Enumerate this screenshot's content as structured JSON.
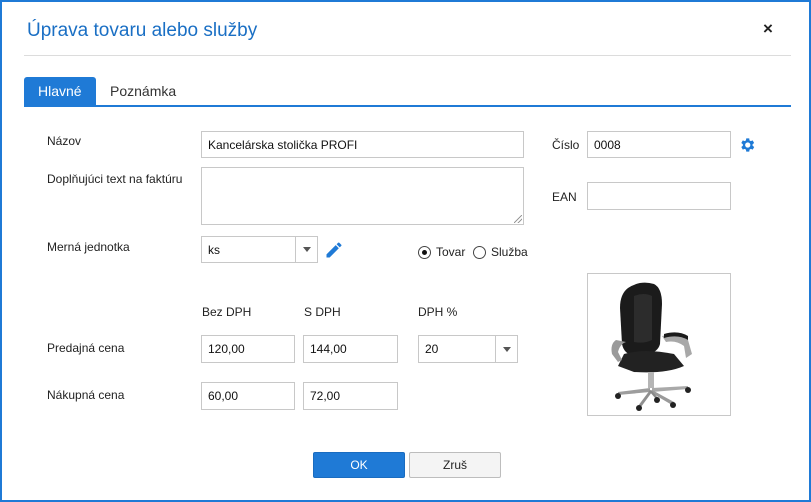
{
  "dialog": {
    "title": "Úprava tovaru alebo služby",
    "close_label": "×"
  },
  "tabs": [
    {
      "label": "Hlavné",
      "active": true
    },
    {
      "label": "Poznámka",
      "active": false
    }
  ],
  "form": {
    "name_label": "Názov",
    "name_value": "Kancelárska stolička PROFI",
    "extra_text_label": "Doplňujúci text na faktúru",
    "extra_text_value": "",
    "number_label": "Číslo",
    "number_value": "0008",
    "ean_label": "EAN",
    "ean_value": "",
    "unit_label": "Merná jednotka",
    "unit_value": "ks",
    "type_options": [
      {
        "label": "Tovar",
        "checked": true
      },
      {
        "label": "Služba",
        "checked": false
      }
    ],
    "col_without_vat": "Bez DPH",
    "col_with_vat": "S DPH",
    "col_vat_pct": "DPH %",
    "sale_price_label": "Predajná cena",
    "sale_price_without_vat": "120,00",
    "sale_price_with_vat": "144,00",
    "vat_pct_value": "20",
    "purchase_price_label": "Nákupná cena",
    "purchase_price_without_vat": "60,00",
    "purchase_price_with_vat": "72,00"
  },
  "buttons": {
    "ok": "OK",
    "cancel": "Zruš"
  },
  "colors": {
    "accent": "#1f7ad6",
    "title": "#1a6fc4"
  },
  "icons": [
    "close-icon",
    "gear-icon",
    "pencil-icon",
    "chevron-down-icon",
    "office-chair-image"
  ]
}
